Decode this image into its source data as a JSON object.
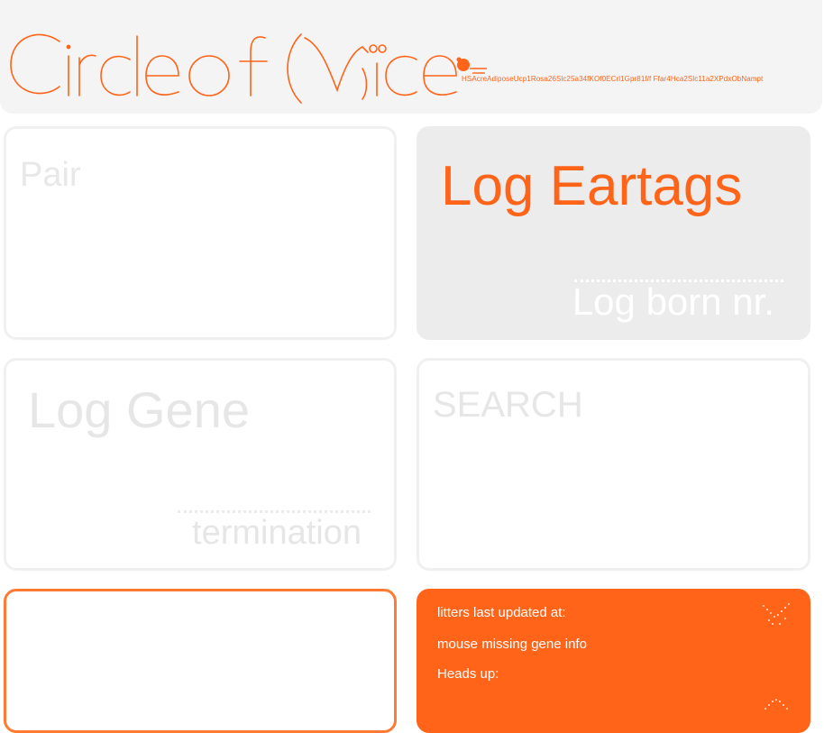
{
  "header": {
    "logo_text": "Circle of Mice",
    "ticker_text": "HSAcreAdiposeUcp1Rosa26Slc25a34fKOf0ECrl1Gpr81f/f Ffar4Hca2Slc11a2XPdxObNampt"
  },
  "tiles": {
    "pair": {
      "title": "Pair"
    },
    "eartags": {
      "title": "Log Eartags",
      "subtitle": "Log born nr."
    },
    "gene": {
      "title": "Log Gene",
      "subtitle": "termination"
    },
    "search": {
      "title": "SEARCH"
    }
  },
  "status": {
    "litters_label": "litters last updated at:",
    "missing_gene_label": "mouse missing gene info",
    "heads_up_label": "Heads up:"
  },
  "colors": {
    "accent": "#ff6419",
    "header_bg": "#f4f4f4",
    "tile_grey": "#ececec",
    "faded_text": "#e6e6e6"
  },
  "icons": {
    "logo_mouse": "mouse-icon",
    "status_spinner": "loading-dots-icon"
  }
}
